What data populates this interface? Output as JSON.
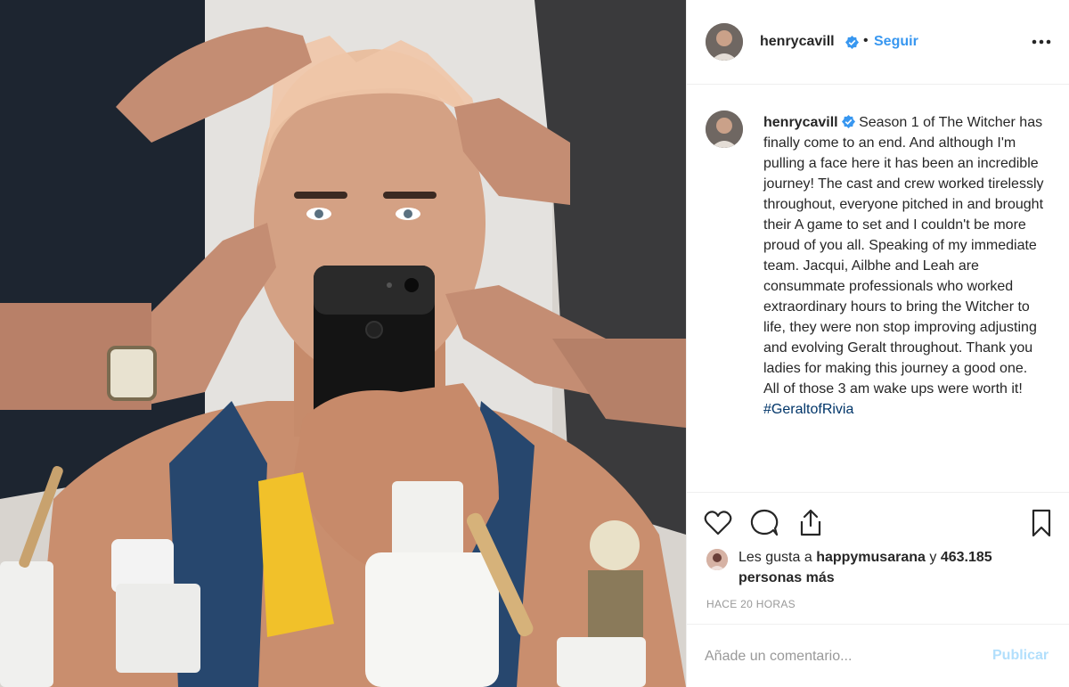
{
  "post": {
    "author": "henrycavill",
    "follow_label": "Seguir",
    "separator": "•",
    "caption_text": "Season 1 of The Witcher has finally come to an end. And although I'm pulling a face here it has been an incredible journey! The cast and crew worked tirelessly throughout, everyone pitched in and brought their A game to set and I couldn't be more proud of you all. Speaking of my immediate team. Jacqui, Ailbhe and Leah are consummate professionals who worked extraordinary hours to bring the Witcher to life, they were non stop improving adjusting and evolving Geralt throughout. Thank you ladies for making this journey a good one. All of those 3 am wake ups were worth it!",
    "hashtag": "#GeraltofRivia"
  },
  "likes": {
    "prefix": "Les gusta a",
    "user": "happymusarana",
    "conjunction": "y",
    "count_text": "463.185 personas más"
  },
  "timestamp": "HACE 20 HORAS",
  "comment": {
    "placeholder": "Añade un comentario...",
    "publish_label": "Publicar"
  },
  "icons": {
    "more": "more-options-icon",
    "like": "heart-icon",
    "comment": "comment-bubble-icon",
    "share": "share-icon",
    "save": "bookmark-icon",
    "verified": "verified-badge-icon"
  },
  "colors": {
    "link": "#3897f0",
    "hashtag": "#003569",
    "text": "#262626",
    "muted": "#999999",
    "publish_disabled": "#b2dffc"
  }
}
